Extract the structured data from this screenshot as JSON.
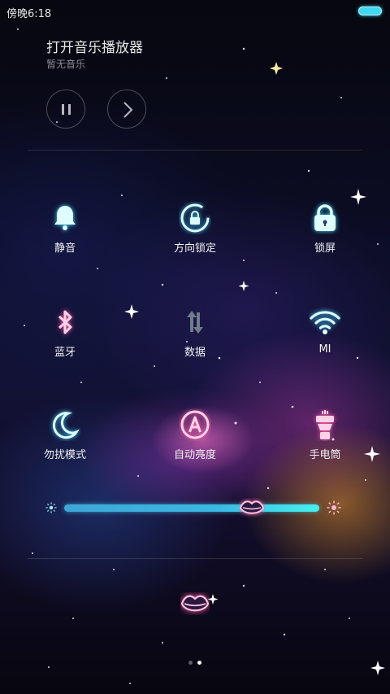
{
  "status_bar": {
    "carrier_time": "傍晚6:18",
    "battery_color": "#3fd7f2"
  },
  "music": {
    "title": "打开音乐播放器",
    "subtitle": "暂无音乐",
    "pause_icon": "pause-icon",
    "next_icon": "chevron-right-icon"
  },
  "toggles": [
    {
      "label": "静音",
      "icon": "bell-icon",
      "color": "#5ff2ff"
    },
    {
      "label": "方向锁定",
      "icon": "rotation-lock-icon",
      "color": "#5ff2ff"
    },
    {
      "label": "锁屏",
      "icon": "padlock-icon",
      "color": "#5ff2ff"
    },
    {
      "label": "蓝牙",
      "icon": "bluetooth-icon",
      "color": "#ff6fae"
    },
    {
      "label": "数据",
      "icon": "data-arrows-icon",
      "color": "#6f7d8a"
    },
    {
      "label": "MI",
      "icon": "wifi-icon",
      "color": "#5ff2ff"
    },
    {
      "label": "勿扰模式",
      "icon": "moon-icon",
      "color": "#5ff2ff"
    },
    {
      "label": "自动亮度",
      "icon": "auto-brightness-icon",
      "color": "#ff6fae"
    },
    {
      "label": "手电筒",
      "icon": "flashlight-icon",
      "color": "#ff6fae"
    }
  ],
  "brightness": {
    "level": 0.72,
    "track_color": "#3ab8e2"
  },
  "pager": {
    "pages": 2,
    "current": 2
  }
}
